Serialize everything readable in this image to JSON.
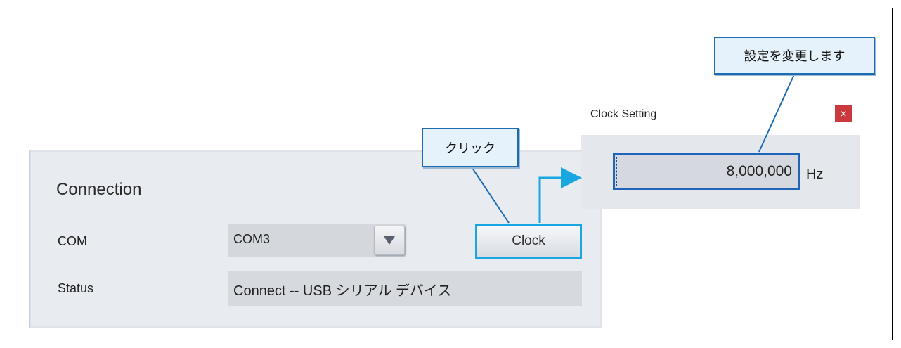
{
  "connection_panel": {
    "title": "Connection",
    "com_label": "COM",
    "com_value": "COM3",
    "status_label": "Status",
    "status_value": "Connect -- USB シリアル デバイス",
    "clock_button": "Clock"
  },
  "clock_dialog": {
    "title": "Clock Setting",
    "close_label": "×",
    "frequency_value": "8,000,000",
    "unit": "Hz"
  },
  "callouts": {
    "click": "クリック",
    "change": "設定を変更します"
  },
  "colors": {
    "callout_border": "#1b6cb3",
    "highlight": "#18a7e0",
    "close_red": "#c9393e"
  }
}
